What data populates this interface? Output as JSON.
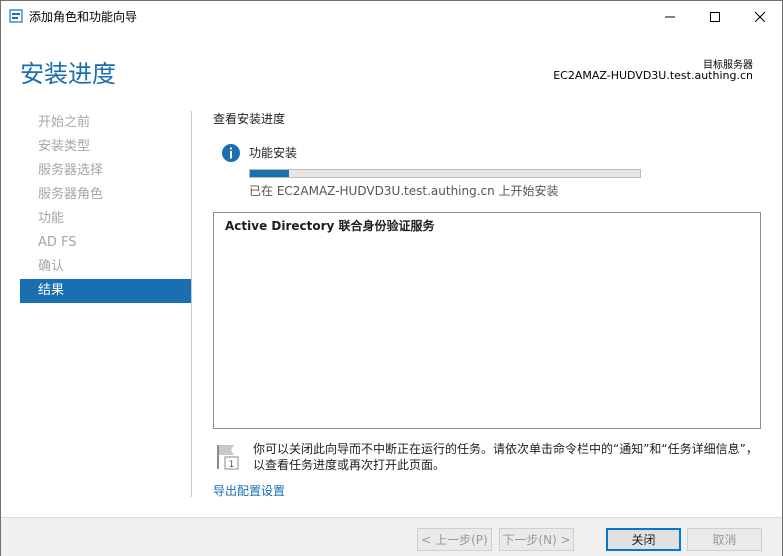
{
  "window": {
    "title": "添加角色和功能向导",
    "minimize_icon": "minimize-icon",
    "maximize_icon": "maximize-icon",
    "close_icon": "close-icon"
  },
  "header": {
    "title": "安装进度",
    "target_label": "目标服务器",
    "target_server": "EC2AMAZ-HUDVD3U.test.authing.cn"
  },
  "nav": {
    "items": [
      {
        "label": "开始之前",
        "active": false
      },
      {
        "label": "安装类型",
        "active": false
      },
      {
        "label": "服务器选择",
        "active": false
      },
      {
        "label": "服务器角色",
        "active": false
      },
      {
        "label": "功能",
        "active": false
      },
      {
        "label": "AD FS",
        "active": false
      },
      {
        "label": "确认",
        "active": false
      },
      {
        "label": "结果",
        "active": true
      }
    ]
  },
  "main": {
    "heading": "查看安装进度",
    "status_title": "功能安装",
    "progress_percent": 10,
    "progress_text": "已在 EC2AMAZ-HUDVD3U.test.authing.cn 上开始安装",
    "results": [
      "Active Directory 联合身份验证服务"
    ],
    "note": "你可以关闭此向导而不中断正在运行的任务。请依次单击命令栏中的“通知”和“任务详细信息”，以查看任务进度或再次打开此页面。",
    "export_link": "导出配置设置"
  },
  "footer": {
    "prev_label": "< 上一步(P)",
    "next_label": "下一步(N) >",
    "close_label": "关闭",
    "cancel_label": "取消"
  },
  "colors": {
    "accent": "#1a6fb0",
    "info_icon": "#1a6fb0"
  }
}
